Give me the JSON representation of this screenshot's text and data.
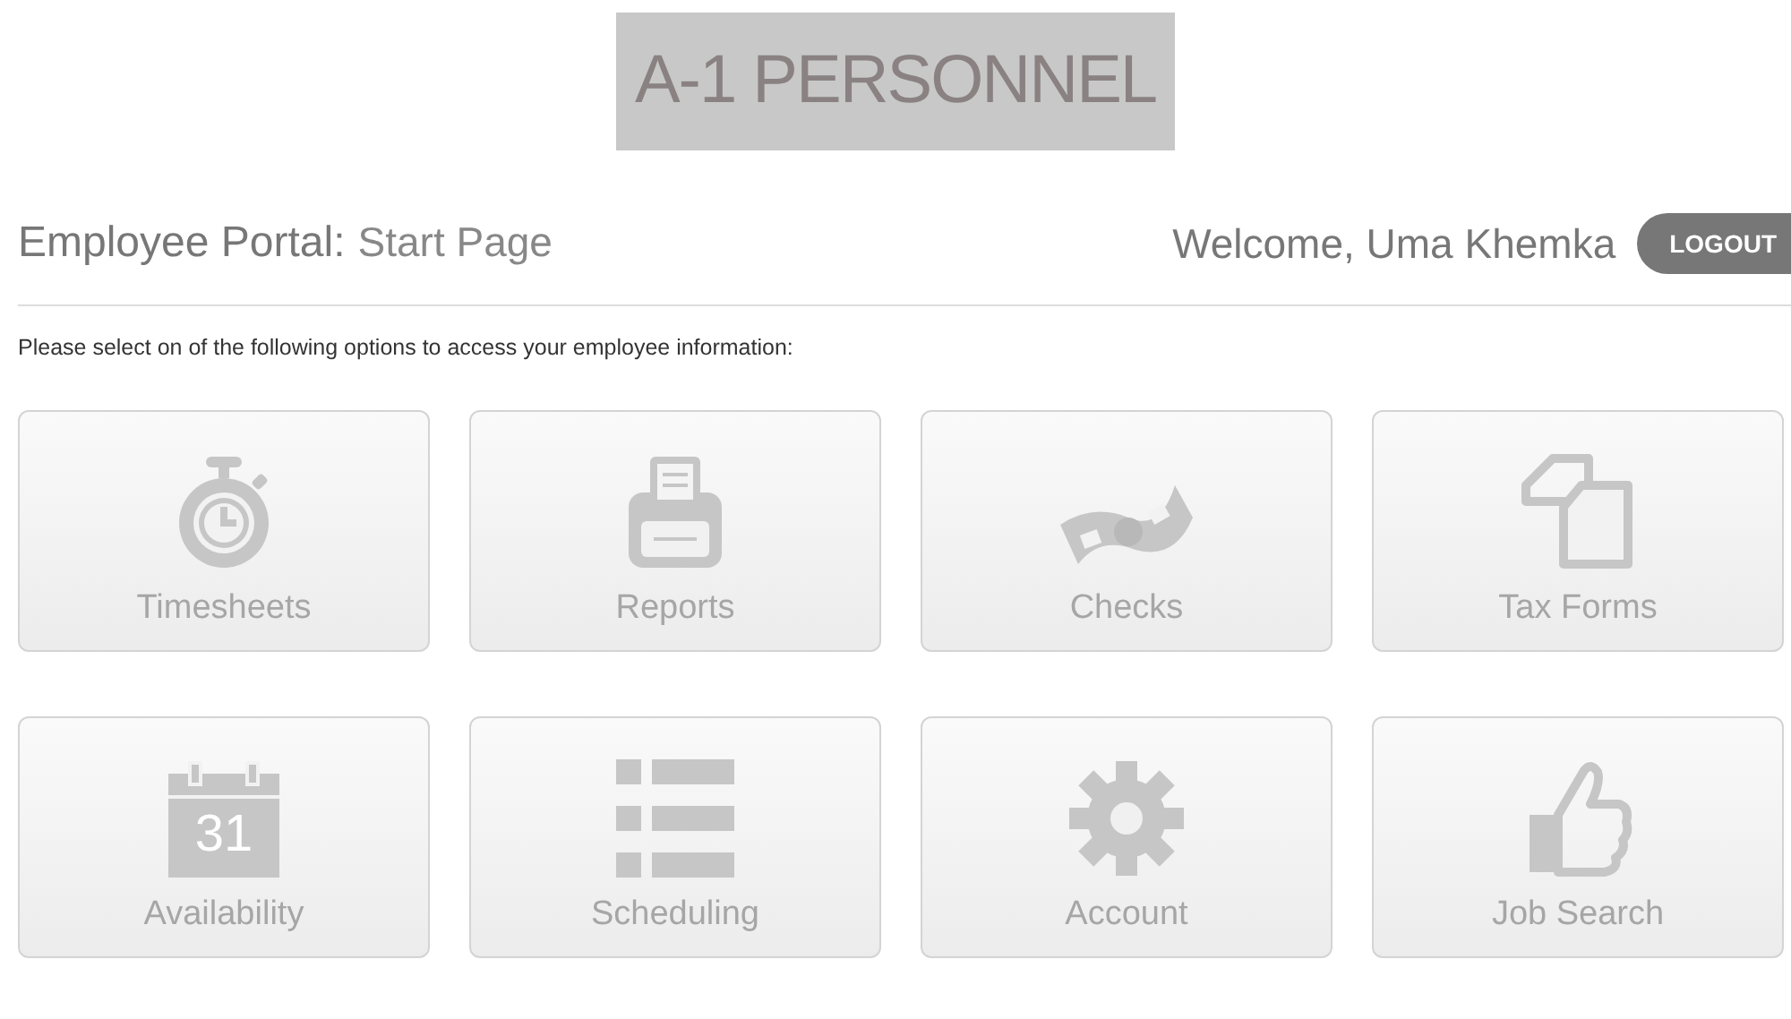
{
  "logo": {
    "text": "A-1 PERSONNEL"
  },
  "header": {
    "title": "Employee Portal:",
    "subtitle": "Start Page",
    "welcome": "Welcome, Uma Khemka",
    "logout": "LOGOUT"
  },
  "intro": "Please select on of the following options to access your employee information:",
  "tiles": [
    {
      "label": "Timesheets"
    },
    {
      "label": "Reports"
    },
    {
      "label": "Checks"
    },
    {
      "label": "Tax Forms"
    },
    {
      "label": "Availability",
      "icon_text": "31"
    },
    {
      "label": "Scheduling"
    },
    {
      "label": "Account"
    },
    {
      "label": "Job Search"
    }
  ]
}
